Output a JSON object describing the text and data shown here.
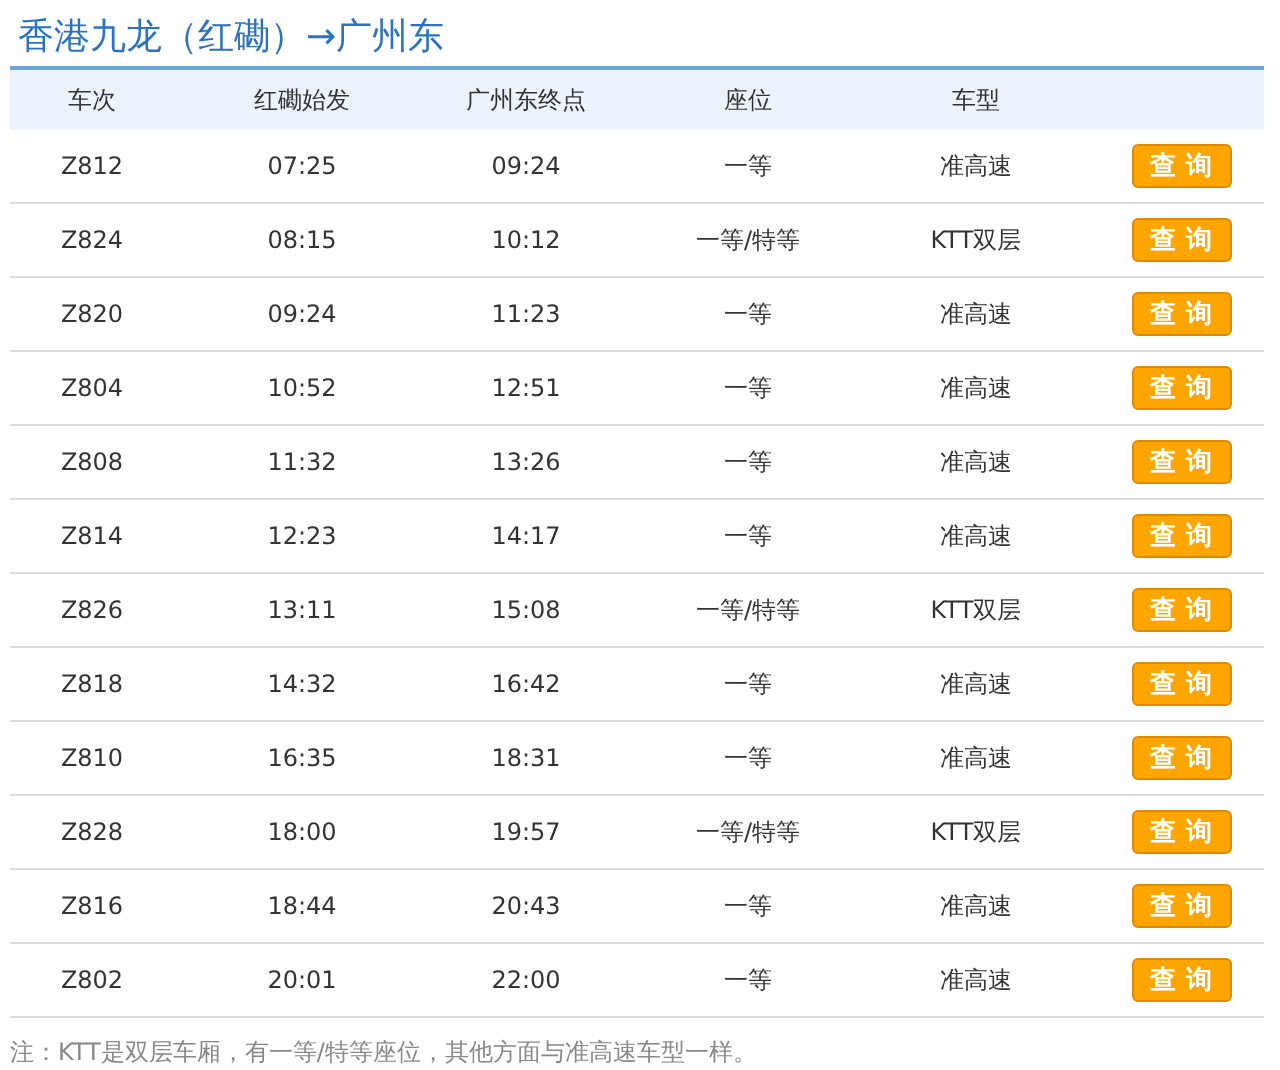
{
  "title": "香港九龙（红磡）→广州东",
  "table": {
    "columns": [
      "车次",
      "红磡始发",
      "广州东终点",
      "座位",
      "车型"
    ],
    "rows": [
      {
        "train": "Z812",
        "depart": "07:25",
        "arrive": "09:24",
        "seat": "一等",
        "type": "准高速",
        "action": "查询"
      },
      {
        "train": "Z824",
        "depart": "08:15",
        "arrive": "10:12",
        "seat": "一等/特等",
        "type": "KTT双层",
        "action": "查询"
      },
      {
        "train": "Z820",
        "depart": "09:24",
        "arrive": "11:23",
        "seat": "一等",
        "type": "准高速",
        "action": "查询"
      },
      {
        "train": "Z804",
        "depart": "10:52",
        "arrive": "12:51",
        "seat": "一等",
        "type": "准高速",
        "action": "查询"
      },
      {
        "train": "Z808",
        "depart": "11:32",
        "arrive": "13:26",
        "seat": "一等",
        "type": "准高速",
        "action": "查询"
      },
      {
        "train": "Z814",
        "depart": "12:23",
        "arrive": "14:17",
        "seat": "一等",
        "type": "准高速",
        "action": "查询"
      },
      {
        "train": "Z826",
        "depart": "13:11",
        "arrive": "15:08",
        "seat": "一等/特等",
        "type": "KTT双层",
        "action": "查询"
      },
      {
        "train": "Z818",
        "depart": "14:32",
        "arrive": "16:42",
        "seat": "一等",
        "type": "准高速",
        "action": "查询"
      },
      {
        "train": "Z810",
        "depart": "16:35",
        "arrive": "18:31",
        "seat": "一等",
        "type": "准高速",
        "action": "查询"
      },
      {
        "train": "Z828",
        "depart": "18:00",
        "arrive": "19:57",
        "seat": "一等/特等",
        "type": "KTT双层",
        "action": "查询"
      },
      {
        "train": "Z816",
        "depart": "18:44",
        "arrive": "20:43",
        "seat": "一等",
        "type": "准高速",
        "action": "查询"
      },
      {
        "train": "Z802",
        "depart": "20:01",
        "arrive": "22:00",
        "seat": "一等",
        "type": "准高速",
        "action": "查询"
      }
    ]
  },
  "note": "注：KTT是双层车厢，有一等/特等座位，其他方面与准高速车型一样。"
}
